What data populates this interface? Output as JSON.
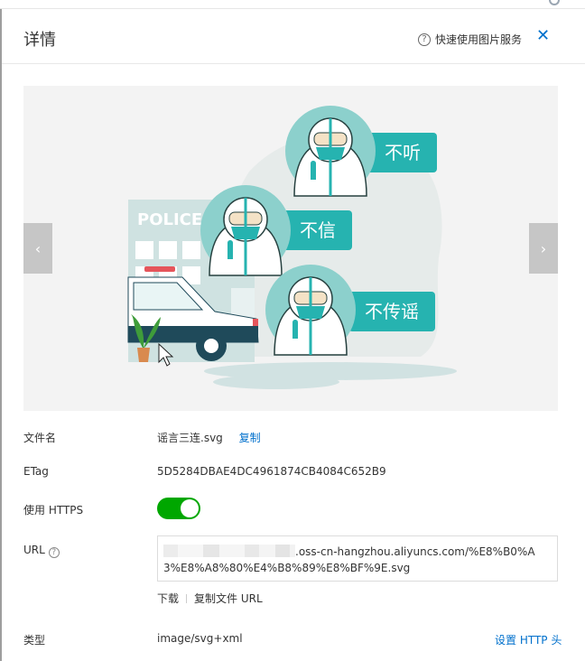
{
  "header": {
    "title": "详情",
    "help_label": "快速使用图片服务"
  },
  "preview": {
    "police_sign": "POLICE",
    "bubble_1": "不听",
    "bubble_2": "不信",
    "bubble_3": "不传谣"
  },
  "details": {
    "filename_label": "文件名",
    "filename_value": "谣言三连.svg",
    "copy_label": "复制",
    "etag_label": "ETag",
    "etag_value": "5D5284DBAE4DC4961874CB4084C652B9",
    "https_label": "使用 HTTPS",
    "https_enabled": true,
    "url_label": "URL",
    "url_value_tail": ".oss-cn-hangzhou.aliyuncs.com/%E8%B0%A3%E8%A8%80%E4%B8%89%E8%BF%9E.svg",
    "download_label": "下载",
    "copy_url_label": "复制文件 URL",
    "type_label": "类型",
    "type_value": "image/svg+xml",
    "set_http_header_label": "设置 HTTP 头"
  },
  "colors": {
    "accent": "#0070cc",
    "toggle_on": "#00a700",
    "teal": "#26b3b0"
  }
}
